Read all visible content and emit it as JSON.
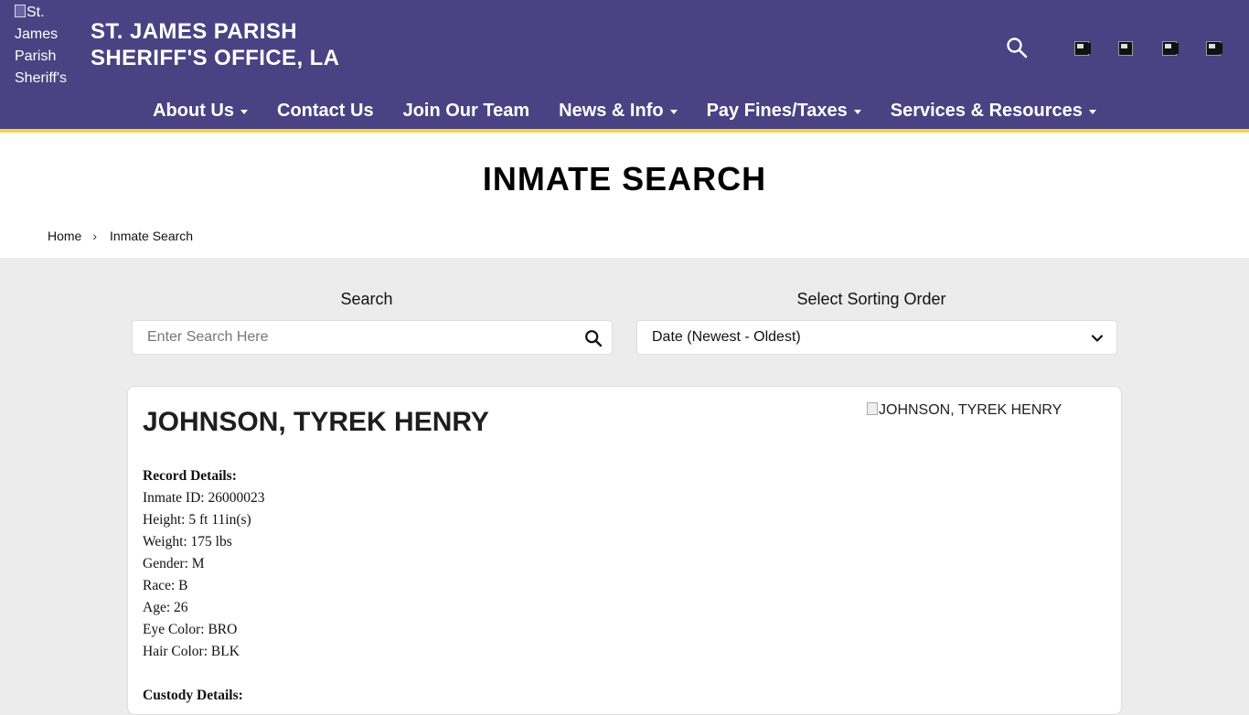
{
  "header": {
    "logo_alt": "St. James Parish Sheriff's",
    "title_line1": "ST. JAMES PARISH",
    "title_line2": "SHERIFF'S OFFICE, LA",
    "colors": {
      "background": "#4b4283",
      "accent_border": "#f3d24b"
    }
  },
  "nav": {
    "items": [
      {
        "label": "About Us",
        "has_dropdown": true
      },
      {
        "label": "Contact Us",
        "has_dropdown": false
      },
      {
        "label": "Join Our Team",
        "has_dropdown": false
      },
      {
        "label": "News & Info",
        "has_dropdown": true
      },
      {
        "label": "Pay Fines/Taxes",
        "has_dropdown": true
      },
      {
        "label": "Services & Resources",
        "has_dropdown": true
      }
    ]
  },
  "page": {
    "title": "INMATE SEARCH",
    "breadcrumb": {
      "home": "Home",
      "separator": "›",
      "current": "Inmate Search"
    }
  },
  "search": {
    "label": "Search",
    "placeholder": "Enter Search Here",
    "value": ""
  },
  "sort": {
    "label": "Select Sorting Order",
    "selected": "Date (Newest - Oldest)"
  },
  "inmate": {
    "name": "JOHNSON, TYREK HENRY",
    "photo_alt": "JOHNSON, TYREK HENRY",
    "record_heading": "Record Details:",
    "record": [
      "Inmate ID: 26000023",
      "Height: 5 ft 11in(s)",
      "Weight: 175 lbs",
      "Gender: M",
      "Race: B",
      "Age: 26",
      "Eye Color: BRO",
      "Hair Color: BLK"
    ],
    "custody_heading": "Custody Details:"
  }
}
